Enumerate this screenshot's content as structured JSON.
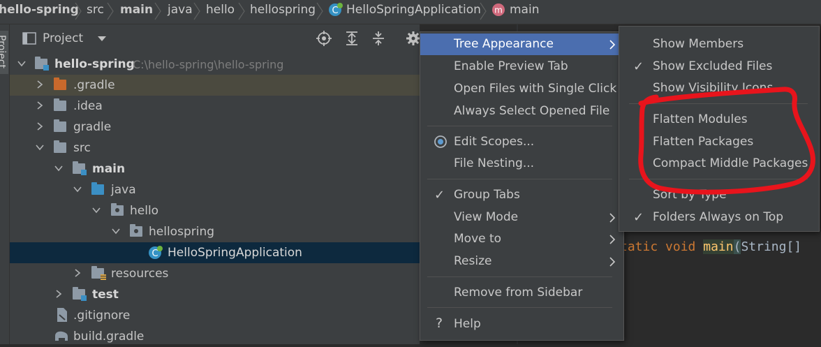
{
  "breadcrumb": {
    "items": [
      "hello-spring",
      "src",
      "main",
      "java",
      "hello",
      "hellospring",
      "HelloSpringApplication",
      "main"
    ]
  },
  "stripe": {
    "label": "Project"
  },
  "panel": {
    "title": "Project",
    "tree": [
      {
        "label": "hello-spring",
        "hint": "C:\\hello-spring\\hello-spring",
        "bold": true
      },
      {
        "label": ".gradle"
      },
      {
        "label": ".idea"
      },
      {
        "label": "gradle"
      },
      {
        "label": "src"
      },
      {
        "label": "main",
        "bold": true
      },
      {
        "label": "java"
      },
      {
        "label": "hello"
      },
      {
        "label": "hellospring"
      },
      {
        "label": "HelloSpringApplication"
      },
      {
        "label": "resources"
      },
      {
        "label": "test",
        "bold": true
      },
      {
        "label": ".gitignore"
      },
      {
        "label": "build.gradle"
      }
    ]
  },
  "menu": {
    "items": [
      "Tree Appearance",
      "Enable Preview Tab",
      "Open Files with Single Click",
      "Always Select Opened File",
      "Edit Scopes...",
      "File Nesting...",
      "Group Tabs",
      "View Mode",
      "Move to",
      "Resize",
      "Remove from Sidebar",
      "Help"
    ]
  },
  "submenu": {
    "items": [
      "Show Members",
      "Show Excluded Files",
      "Show Visibility Icons",
      "Flatten Modules",
      "Flatten Packages",
      "Compact Middle Packages",
      "Sort by Type",
      "Folders Always on Top"
    ]
  },
  "editor": {
    "code_kw1": "tatic",
    "code_kw2": "void",
    "code_fn": "main",
    "code_paren": "(",
    "code_rest": "String[]"
  },
  "colors": {
    "selection": "#4b6eaf",
    "annotation": "#e8141c",
    "folder": "#8e9aa6",
    "gradle_folder": "#c9692c",
    "source_folder": "#3b8fc4",
    "class_icon": "#3592c4"
  }
}
